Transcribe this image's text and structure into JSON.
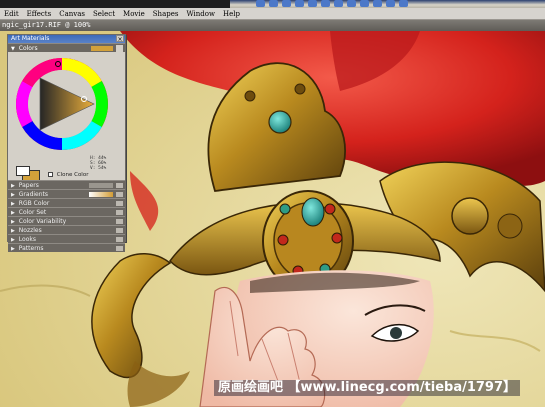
{
  "app": {
    "menus": [
      "Edit",
      "Effects",
      "Canvas",
      "Select",
      "Movie",
      "Shapes",
      "Window",
      "Help"
    ],
    "document_title": "ngic_gir17.RIF @ 100%"
  },
  "palette": {
    "title": "Art Materials",
    "close_glyph": "×",
    "colors": {
      "header": "Colors",
      "current_color": "#d3a13a",
      "hsv_readout": [
        "H: 44%",
        "S: 66%",
        "V: 54%"
      ],
      "clone_color_label": "Clone Color"
    },
    "sections": [
      "Papers",
      "Gradients",
      "RGB Color",
      "Color Set",
      "Color Variability",
      "Nozzles",
      "Looks",
      "Patterns"
    ]
  },
  "watermark": {
    "text": "原画绘画吧 【www.linecg.com/tieba/1797】"
  },
  "icons": {
    "expand": "triangle-right-icon",
    "collapse": "triangle-down-icon",
    "close": "close-icon"
  }
}
